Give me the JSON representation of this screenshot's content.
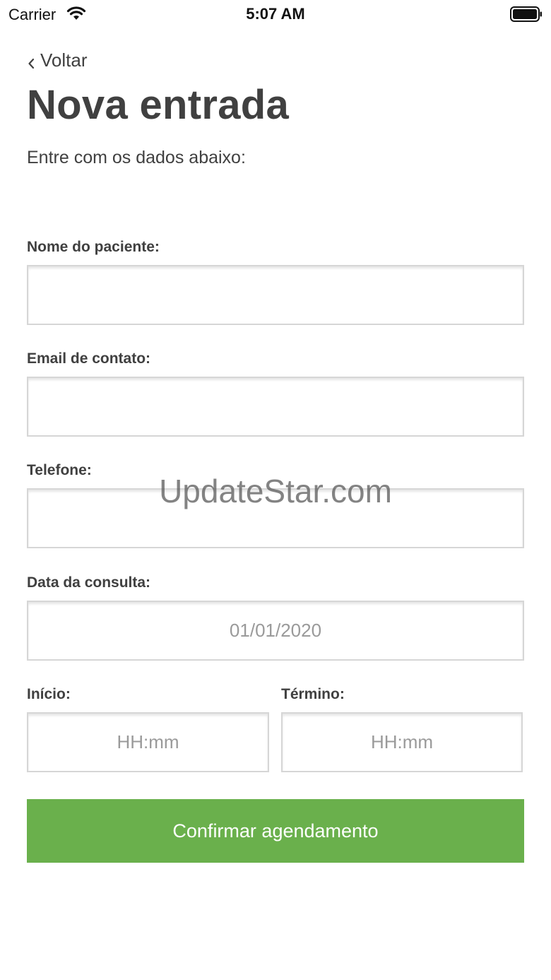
{
  "status_bar": {
    "carrier": "Carrier",
    "time": "5:07 AM",
    "wifi_icon": "wifi-icon",
    "battery_icon": "battery-icon"
  },
  "nav": {
    "back_label": "Voltar",
    "back_icon": "chevron-left-icon"
  },
  "header": {
    "title": "Nova entrada",
    "subtitle": "Entre com os dados abaixo:"
  },
  "form": {
    "patient_name": {
      "label": "Nome do paciente:",
      "value": "",
      "placeholder": ""
    },
    "email": {
      "label": "Email de contato:",
      "value": "",
      "placeholder": ""
    },
    "phone": {
      "label": "Telefone:",
      "value": "",
      "placeholder": ""
    },
    "date": {
      "label": "Data da consulta:",
      "value": "",
      "placeholder": "01/01/2020"
    },
    "start": {
      "label": "Início:",
      "value": "",
      "placeholder": "HH:mm"
    },
    "end": {
      "label": "Término:",
      "value": "",
      "placeholder": "HH:mm"
    },
    "submit_label": "Confirmar agendamento"
  },
  "colors": {
    "accent": "#6ab04c",
    "text": "#404040",
    "input_border": "#d6d6d6",
    "placeholder": "#9a9a9a"
  },
  "watermark": "UpdateStar.com"
}
